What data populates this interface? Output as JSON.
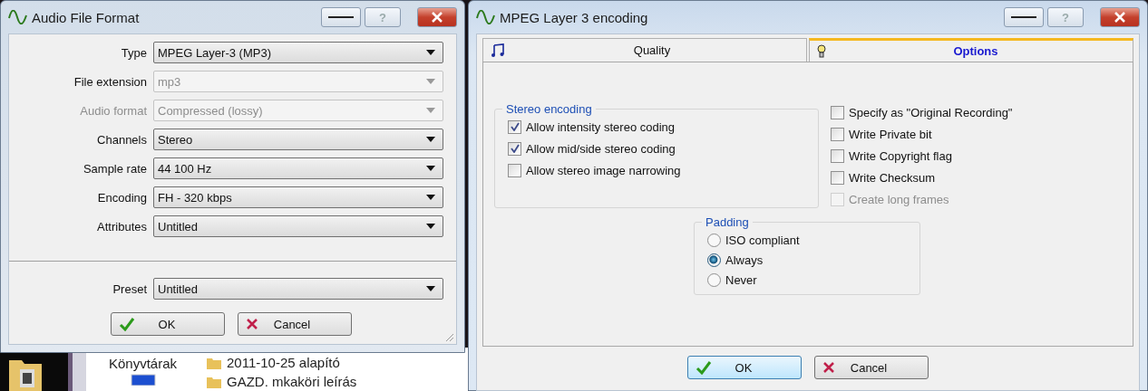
{
  "format_dialog": {
    "title": "Audio File Format",
    "help_label": "?",
    "fields": [
      {
        "label": "Type",
        "value": "MPEG Layer-3 (MP3)",
        "disabled": false,
        "label_disabled": false
      },
      {
        "label": "File extension",
        "value": "mp3",
        "disabled": true,
        "label_disabled": false
      },
      {
        "label": "Audio format",
        "value": "Compressed (lossy)",
        "disabled": true,
        "label_disabled": true
      },
      {
        "label": "Channels",
        "value": "Stereo",
        "disabled": false,
        "label_disabled": false
      },
      {
        "label": "Sample rate",
        "value": "44 100 Hz",
        "disabled": false,
        "label_disabled": false
      },
      {
        "label": "Encoding",
        "value": "FH - 320 kbps",
        "disabled": false,
        "label_disabled": false
      },
      {
        "label": "Attributes",
        "value": "Untitled",
        "disabled": false,
        "label_disabled": false
      }
    ],
    "preset": {
      "label": "Preset",
      "value": "Untitled"
    },
    "buttons": [
      {
        "label": "OK",
        "kind": "ok"
      },
      {
        "label": "Cancel",
        "kind": "cancel"
      }
    ]
  },
  "encoding_dialog": {
    "title": "MPEG Layer 3 encoding",
    "help_label": "?",
    "tabs": [
      {
        "label": "Quality",
        "kind": "notes",
        "selected": false
      },
      {
        "label": "Options",
        "kind": "bulb",
        "selected": true
      }
    ],
    "stereo_group": {
      "title": "Stereo encoding",
      "options": [
        {
          "label": "Allow intensity stereo coding",
          "checked": true
        },
        {
          "label": "Allow mid/side stereo coding",
          "checked": true
        },
        {
          "label": "Allow stereo image narrowing",
          "checked": false
        }
      ]
    },
    "flags": [
      {
        "label": "Specify as \"Original Recording\"",
        "checked": false,
        "disabled": false
      },
      {
        "label": "Write Private bit",
        "checked": false,
        "disabled": false
      },
      {
        "label": "Write Copyright flag",
        "checked": false,
        "disabled": false
      },
      {
        "label": "Write Checksum",
        "checked": false,
        "disabled": false
      },
      {
        "label": "Create long frames",
        "checked": false,
        "disabled": true
      }
    ],
    "padding_group": {
      "title": "Padding",
      "options": [
        {
          "label": "ISO compliant",
          "selected": false
        },
        {
          "label": "Always",
          "selected": true
        },
        {
          "label": "Never",
          "selected": false
        }
      ]
    },
    "buttons": [
      {
        "label": "OK",
        "kind": "ok"
      },
      {
        "label": "Cancel",
        "kind": "cancel"
      }
    ]
  },
  "desktop": {
    "sidebar_label": "Könyvtárak",
    "files": [
      "2011-10-25 alapító",
      "GAZD. mkaköri leírás"
    ]
  }
}
